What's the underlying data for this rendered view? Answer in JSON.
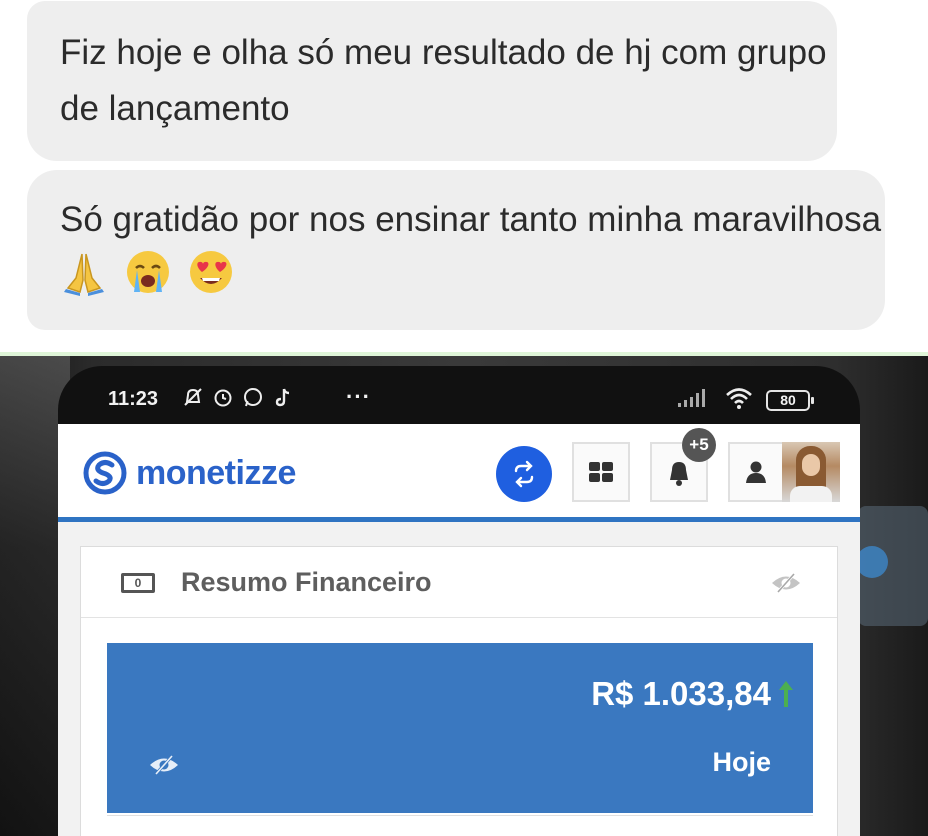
{
  "messages": [
    {
      "text": "Fiz hoje e olha só meu resultado de hj com grupo de lançamento"
    },
    {
      "text": "Só gratidão por nos ensinar tanto minha maravilhosa",
      "emojis": [
        "folded-hands",
        "loudly-crying-face",
        "heart-eyes-face"
      ]
    }
  ],
  "phone_status": {
    "time": "11:23",
    "dots": "···",
    "battery": "80",
    "icons": [
      "bell-off-icon",
      "alarm-icon",
      "whatsapp-icon",
      "tiktok-icon",
      "signal-icon",
      "wifi-icon"
    ]
  },
  "app": {
    "brand": "monetizze",
    "notification_badge": "+5",
    "card_title": "Resumo Financeiro",
    "money_icon_glyph": "0",
    "amount": "R$ 1.033,84",
    "period": "Hoje",
    "colors": {
      "brand_blue": "#2a62c9",
      "panel_blue": "#3a78c0",
      "arrow_green": "#4caf50",
      "switch_blue": "#1f5fe0"
    }
  }
}
